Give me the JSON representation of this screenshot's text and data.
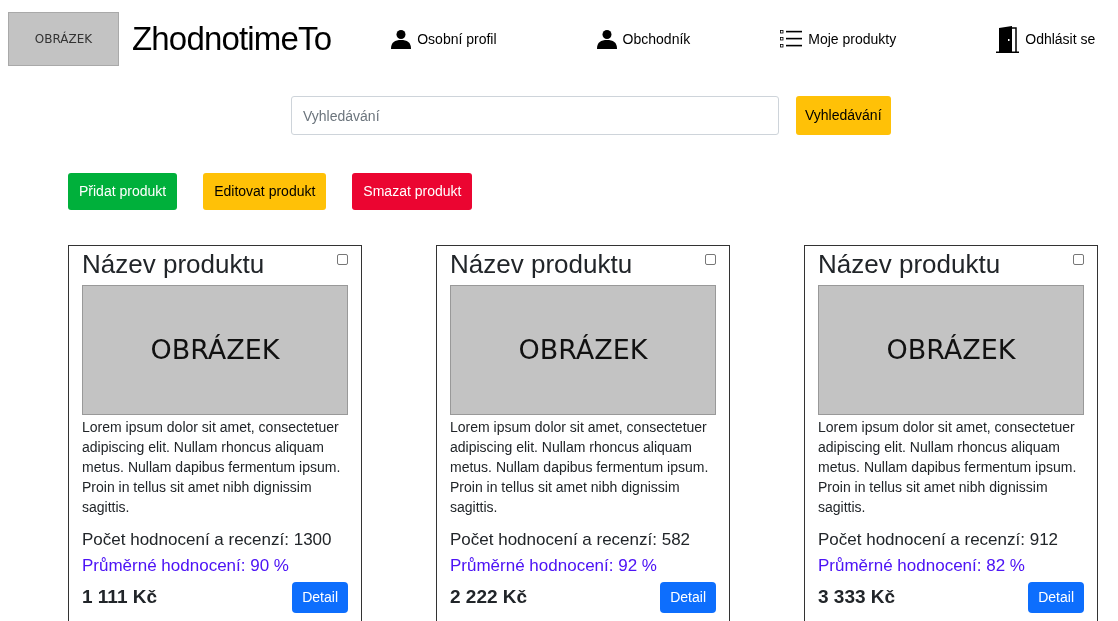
{
  "header": {
    "logo_placeholder": "OBRÁZEK",
    "brand": "ZhodnotimeTo",
    "nav": [
      {
        "kind": "person",
        "label": "Osobní profil"
      },
      {
        "kind": "person",
        "label": "Obchodník"
      },
      {
        "kind": "list",
        "label": "Moje produkty"
      },
      {
        "kind": "door",
        "label": "Odhlásit se"
      }
    ]
  },
  "search": {
    "placeholder": "Vyhledávání",
    "button": "Vyhledávání"
  },
  "actions": [
    {
      "kind": "add",
      "label": "Přidat produkt"
    },
    {
      "kind": "edit",
      "label": "Editovat produkt"
    },
    {
      "kind": "delete",
      "label": "Smazat produkt"
    }
  ],
  "products": [
    {
      "name": "Název produktu",
      "checked": false,
      "image_placeholder": "OBRÁZEK",
      "description": "Lorem ipsum dolor sit amet, consectetuer adipiscing elit. Nullam rhoncus aliquam metus. Nullam dapibus fermentum ipsum. Proin in tellus sit amet nibh dignissim sagittis.",
      "reviews": "Počet hodnocení a recenzí: 1300",
      "rating": "Průměrné hodnocení: 90 %",
      "price": "1 111 Kč",
      "button": "Detail"
    },
    {
      "name": "Název produktu",
      "checked": false,
      "image_placeholder": "OBRÁZEK",
      "description": "Lorem ipsum dolor sit amet, consectetuer adipiscing elit. Nullam rhoncus aliquam metus. Nullam dapibus fermentum ipsum. Proin in tellus sit amet nibh dignissim sagittis.",
      "reviews": "Počet hodnocení a recenzí: 582",
      "rating": "Průměrné hodnocení: 92 %",
      "price": "2 222 Kč",
      "button": "Detail"
    },
    {
      "name": "Název produktu",
      "checked": false,
      "image_placeholder": "OBRÁZEK",
      "description": "Lorem ipsum dolor sit amet, consectetuer adipiscing elit. Nullam rhoncus aliquam metus. Nullam dapibus fermentum ipsum. Proin in tellus sit amet nibh dignissim sagittis.",
      "reviews": "Počet hodnocení a recenzí: 912",
      "rating": "Průměrné hodnocení: 82 %",
      "price": "3 333 Kč",
      "button": "Detail"
    }
  ]
}
